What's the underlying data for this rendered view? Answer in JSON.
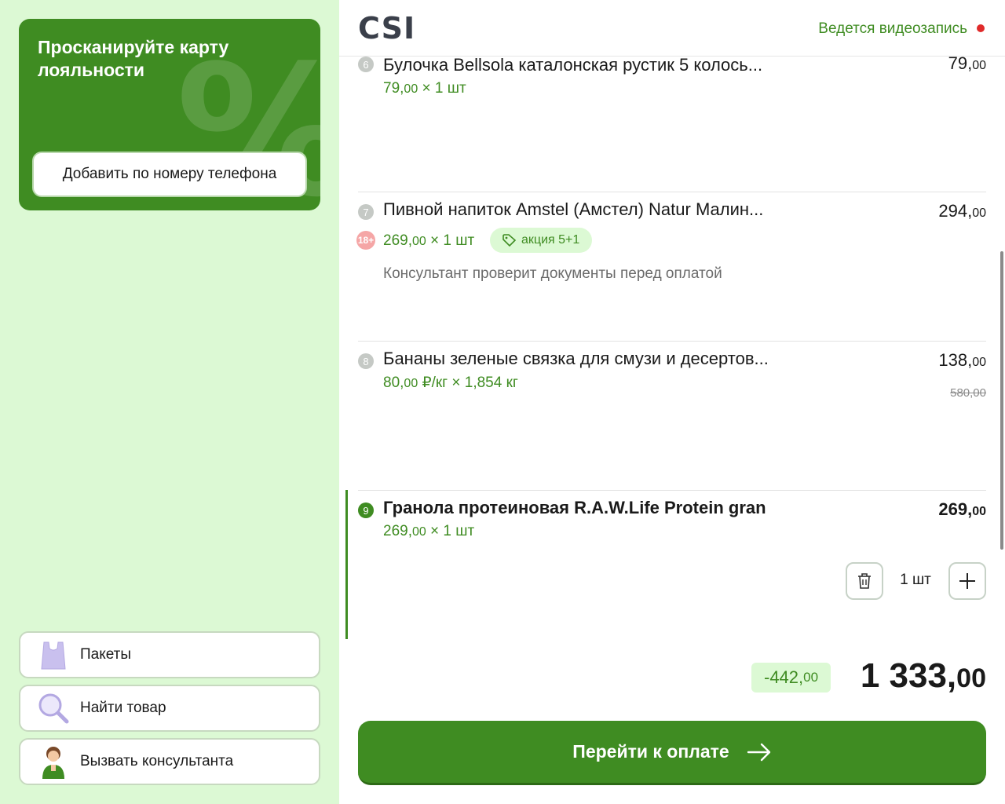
{
  "sidebar": {
    "loyalty_title": "Просканируйте карту лояльности",
    "loyalty_deco": "%",
    "phone_button": "Добавить по номеру телефона",
    "buttons": [
      {
        "label": "Пакеты",
        "icon": "bag-icon"
      },
      {
        "label": "Найти товар",
        "icon": "magnifier-icon"
      },
      {
        "label": "Вызвать консультанта",
        "icon": "consultant-icon"
      }
    ]
  },
  "header": {
    "logo": "CSI",
    "recording": "Ведется видеозапись"
  },
  "cart": {
    "items": [
      {
        "number": "6",
        "name": "Булочка Bellsola каталонская рустик 5 колось...",
        "price_int": "79,",
        "price_dec": "00",
        "unit_int": "79,",
        "unit_dec": "00",
        "unit_qty": " × 1 шт"
      },
      {
        "number": "7",
        "name": "Пивной напиток Amstel (Амстел) Natur Малин...",
        "price_int": "294,",
        "price_dec": "00",
        "unit_int": "269,",
        "unit_dec": "00",
        "unit_qty": " × 1 шт",
        "age_badge": "18+",
        "promo": "акция 5+1",
        "note": "Консультант проверит документы перед оплатой"
      },
      {
        "number": "8",
        "name": "Бананы зеленые связка для смузи и десертов...",
        "price_int": "138,",
        "price_dec": "00",
        "old_price": "580,00",
        "unit_int": "80,",
        "unit_dec": "00",
        "unit_qty": " ₽/кг × 1,854 кг"
      },
      {
        "number": "9",
        "name": "Гранола протеиновая R.A.W.Life Protein gran",
        "price_int": "269,",
        "price_dec": "00",
        "unit_int": "269,",
        "unit_dec": "00",
        "unit_qty": " × 1 шт",
        "quantity": "1 шт"
      }
    ]
  },
  "summary": {
    "discount_int": "-442,",
    "discount_dec": "00",
    "total_int": "1 333,",
    "total_dec": "00"
  },
  "pay_button": "Перейти к оплате",
  "colors": {
    "brand_green": "#3f8c22",
    "sidebar_bg": "#dcf9d4",
    "record_dot": "#e02a2a"
  }
}
